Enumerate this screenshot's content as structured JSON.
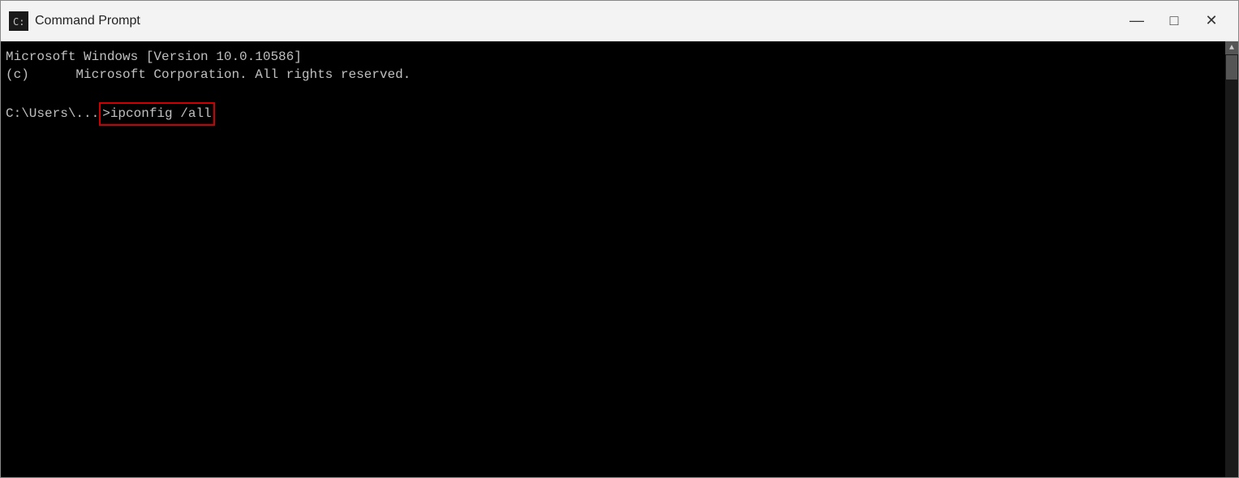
{
  "titleBar": {
    "title": "Command Prompt",
    "minimizeLabel": "—",
    "maximizeLabel": "□",
    "closeLabel": "✕"
  },
  "terminal": {
    "line1": "Microsoft Windows [Version 10.0.10586]",
    "line2": "(c)      Microsoft Corporation. All rights reserved.",
    "line3": "",
    "promptPrefix": "C:\\Users\\...",
    "command": ">ipconfig /all"
  },
  "scrollbar": {
    "upArrow": "▲"
  }
}
